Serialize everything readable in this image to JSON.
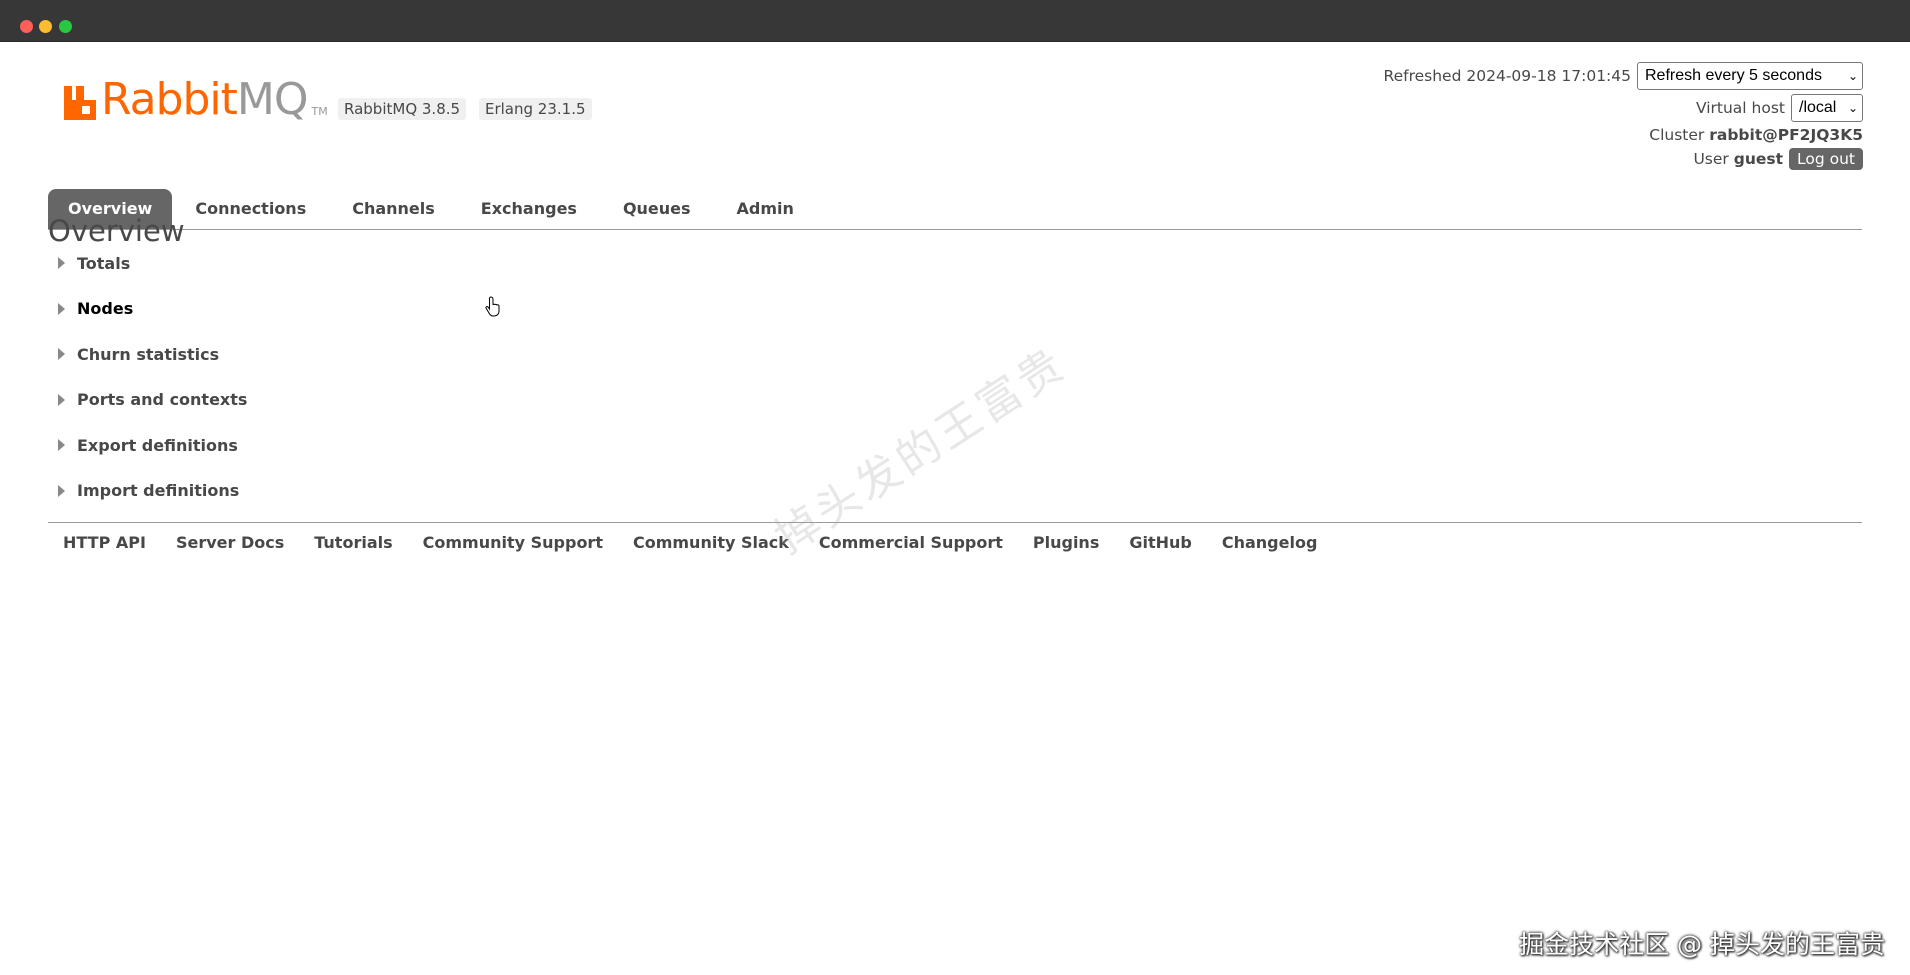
{
  "header": {
    "version_rabbitmq": "RabbitMQ 3.8.5",
    "version_erlang": "Erlang 23.1.5",
    "refreshed_label": "Refreshed",
    "refreshed_time": "2024-09-18 17:01:45",
    "refresh_select": "Refresh every 5 seconds",
    "vhost_label": "Virtual host",
    "vhost_select": "/local",
    "cluster_label": "Cluster",
    "cluster_name": "rabbit@PF2JQ3K5",
    "user_label": "User",
    "user_name": "guest",
    "logout_label": "Log out"
  },
  "logo": {
    "rabbit": "Rabbit",
    "mq": "MQ",
    "tm": "TM",
    "accent": "#ff6600"
  },
  "tabs": [
    {
      "label": "Overview",
      "active": true
    },
    {
      "label": "Connections"
    },
    {
      "label": "Channels"
    },
    {
      "label": "Exchanges"
    },
    {
      "label": "Queues"
    },
    {
      "label": "Admin"
    }
  ],
  "main": {
    "title": "Overview",
    "sections": [
      "Totals",
      "Nodes",
      "Churn statistics",
      "Ports and contexts",
      "Export definitions",
      "Import definitions"
    ]
  },
  "footer": {
    "links": [
      "HTTP API",
      "Server Docs",
      "Tutorials",
      "Community Support",
      "Community Slack",
      "Commercial Support",
      "Plugins",
      "GitHub",
      "Changelog"
    ]
  },
  "watermark": "掉头发的王富贵",
  "credit": "掘金技术社区 @ 掉头发的王富贵"
}
